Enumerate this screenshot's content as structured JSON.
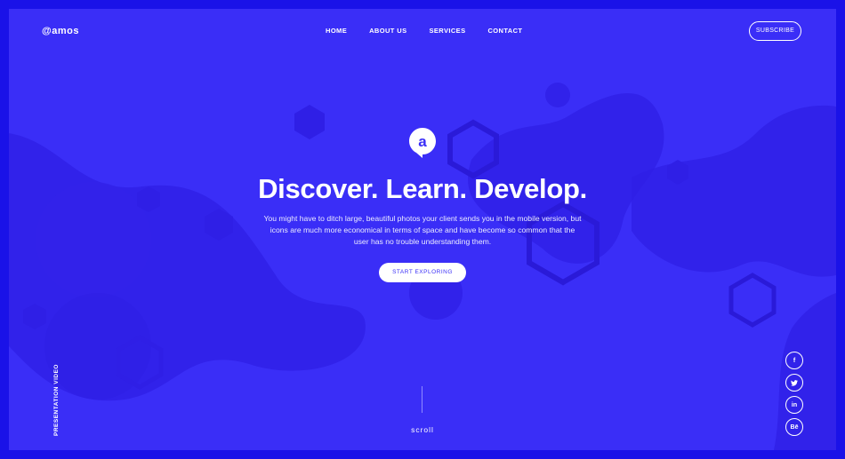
{
  "brand": {
    "logo_text": "amos",
    "logo_mark": "@"
  },
  "nav": {
    "items": [
      {
        "label": "HOME",
        "active": true
      },
      {
        "label": "ABOUT US",
        "active": false
      },
      {
        "label": "SERVICES",
        "active": false
      },
      {
        "label": "CONTACT",
        "active": false
      }
    ],
    "subscribe_label": "SUBSCRIBE"
  },
  "hero": {
    "icon": "a-letter-chat-icon",
    "title": "Discover. Learn. Develop.",
    "text": "You might have to ditch large, beautiful photos your client sends you in the mobile version, but icons are much more economical in terms of space and have become so common that the user has no trouble understanding them.",
    "cta_label": "START EXPLORING"
  },
  "side": {
    "presentation_label": "PRESENTATION VIDEO",
    "scroll_label": "scroll"
  },
  "social": [
    {
      "icon": "facebook-icon",
      "glyph": "f"
    },
    {
      "icon": "twitter-icon",
      "glyph": "t"
    },
    {
      "icon": "linkedin-icon",
      "glyph": "in"
    },
    {
      "icon": "behance-icon",
      "glyph": "Bē"
    }
  ],
  "colors": {
    "accent": "#3a2ef7",
    "frame": "#1a12e8",
    "blob": "#2f1fe6",
    "highlight": "#3f8cff"
  }
}
